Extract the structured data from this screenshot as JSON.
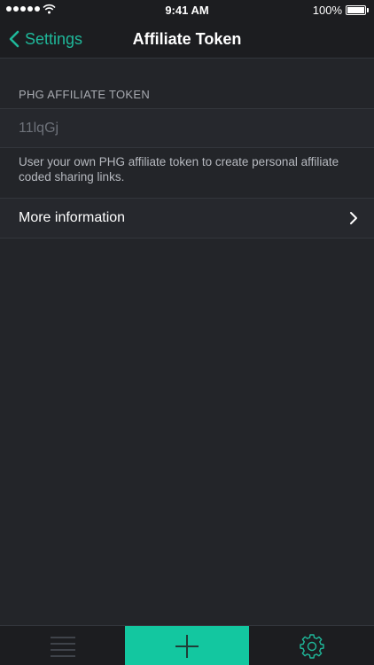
{
  "status_bar": {
    "time": "9:41 AM",
    "battery_percent": "100%",
    "signal_icon": "signal-dots-icon",
    "wifi_icon": "wifi-icon",
    "battery_icon": "battery-icon",
    "battery_level": 1.0
  },
  "nav": {
    "back_label": "Settings",
    "back_icon": "chevron-left-icon",
    "title": "Affiliate Token"
  },
  "section": {
    "header": "PHG AFFILIATE TOKEN",
    "token_value": "11lqGj",
    "footer": "User your own PHG affiliate token to create personal affiliate coded sharing links."
  },
  "more_row": {
    "label": "More information",
    "icon": "chevron-right-icon"
  },
  "tab_bar": {
    "items": [
      {
        "icon": "list-icon",
        "active": false
      },
      {
        "icon": "plus-icon",
        "active": true
      },
      {
        "icon": "gear-icon",
        "active": false
      }
    ]
  },
  "colors": {
    "accent": "#1fb89a",
    "add_tab_bg": "#13c7a0",
    "background": "#232529",
    "bar_background": "#1c1d20",
    "cell_background": "#26282d"
  }
}
